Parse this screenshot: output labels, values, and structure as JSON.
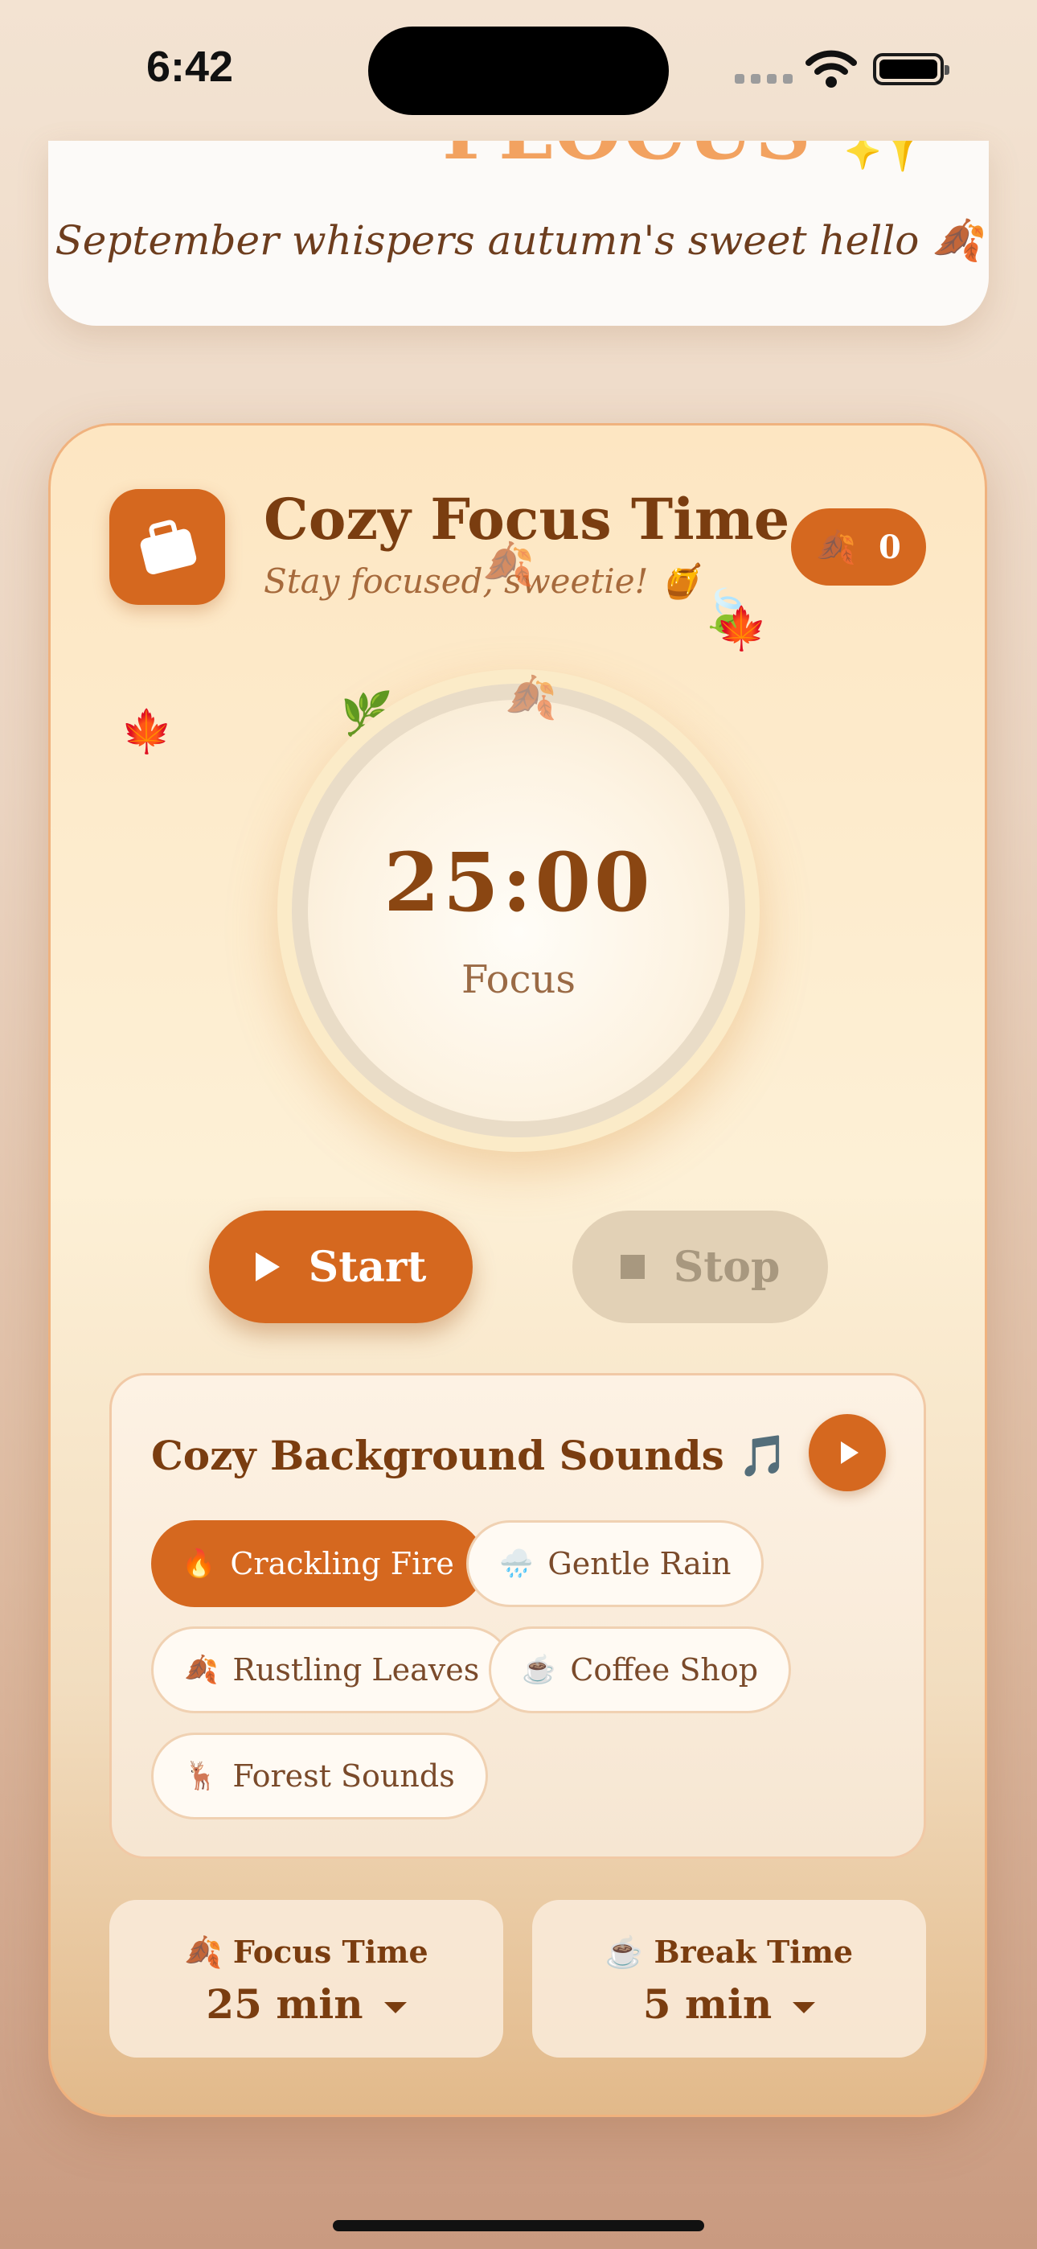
{
  "status": {
    "time": "6:42"
  },
  "top_card": {
    "cut_title": "FLOCUS ✨",
    "tagline": "September whispers autumn's sweet hello 🍂"
  },
  "header": {
    "title": "Cozy Focus Time",
    "subtitle": "Stay focused, sweetie! 🍯",
    "icon": "briefcase-icon",
    "session_count": "0",
    "session_icon": "🍂"
  },
  "timer": {
    "value": "25:00",
    "mode": "Focus"
  },
  "controls": {
    "start_label": "Start",
    "stop_label": "Stop"
  },
  "sounds": {
    "title": "Cozy Background Sounds 🎵",
    "options": [
      {
        "emoji": "🔥",
        "label": "Crackling Fire",
        "active": true
      },
      {
        "emoji": "🌧️",
        "label": "Gentle Rain",
        "active": false
      },
      {
        "emoji": "🍂",
        "label": "Rustling Leaves",
        "active": false
      },
      {
        "emoji": "☕",
        "label": "Coffee Shop",
        "active": false
      },
      {
        "emoji": "🦌",
        "label": "Forest Sounds",
        "active": false
      }
    ]
  },
  "settings": {
    "focus": {
      "icon": "🍂",
      "label": "Focus Time",
      "value": "25 min"
    },
    "break": {
      "icon": "☕",
      "label": "Break Time",
      "value": "5 min"
    }
  },
  "colors": {
    "accent": "#d5681f",
    "text": "#7a3d10",
    "card": "#fdf0d6"
  }
}
